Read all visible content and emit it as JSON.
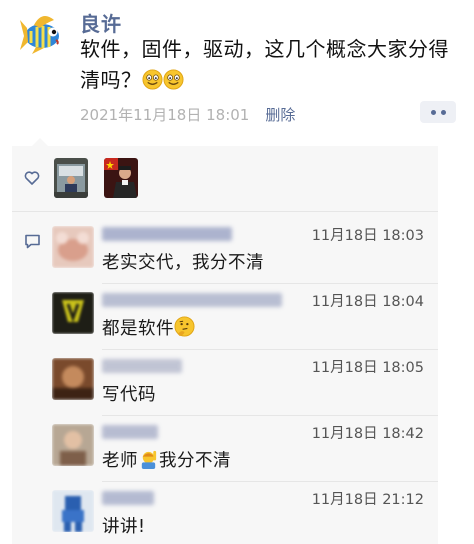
{
  "post": {
    "author": "良许",
    "text_line1": "软件，固件，驱动，这几个概念大家分得",
    "text_line2": "清吗？",
    "timestamp": "2021年11月18日 18:01",
    "delete_label": "删除",
    "more_icon": "more-dots-icon"
  },
  "likes": {
    "icon": "heart-outline-icon",
    "count": 2
  },
  "comments_icon": "comment-bubble-icon",
  "comments": [
    {
      "time": "11月18日 18:03",
      "text": "老实交代，我分不清"
    },
    {
      "time": "11月18日 18:04",
      "text": "都是软件"
    },
    {
      "time": "11月18日 18:05",
      "text": "写代码"
    },
    {
      "time": "11月18日 18:42",
      "text_before": "老师",
      "text_after": "我分不清"
    },
    {
      "time": "11月18日 21:12",
      "text": "讲讲!"
    }
  ],
  "colors": {
    "link": "#576b95",
    "panel_bg": "#f7f7f7",
    "meta_gray": "#b2b2b2"
  }
}
